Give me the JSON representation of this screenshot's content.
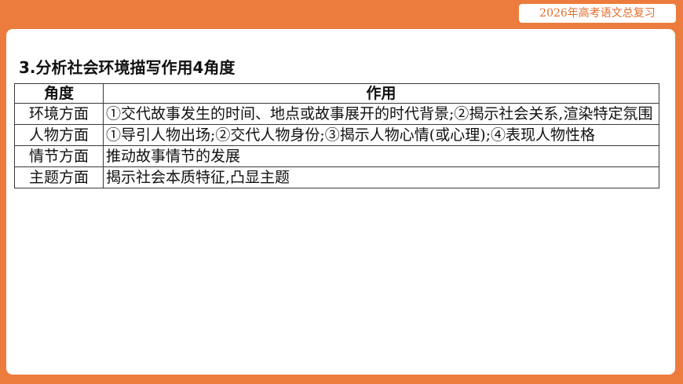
{
  "header": {
    "badge": "2026年高考语文总复习"
  },
  "section": {
    "title": "3.分析社会环境描写作用4角度"
  },
  "table": {
    "headers": [
      "角度",
      "作用"
    ],
    "rows": [
      {
        "aspect": "环境方面",
        "role": "①交代故事发生的时间、地点或故事展开的时代背景;②揭示社会关系,渲染特定氛围"
      },
      {
        "aspect": "人物方面",
        "role": "①导引人物出场;②交代人物身份;③揭示人物心情(或心理);④表现人物性格"
      },
      {
        "aspect": "情节方面",
        "role": "推动故事情节的发展"
      },
      {
        "aspect": "主题方面",
        "role": "揭示社会本质特征,凸显主题"
      }
    ]
  },
  "colors": {
    "frame": "#ec7c3e",
    "badge_text": "#e26d2c",
    "panel": "#ffffff"
  }
}
